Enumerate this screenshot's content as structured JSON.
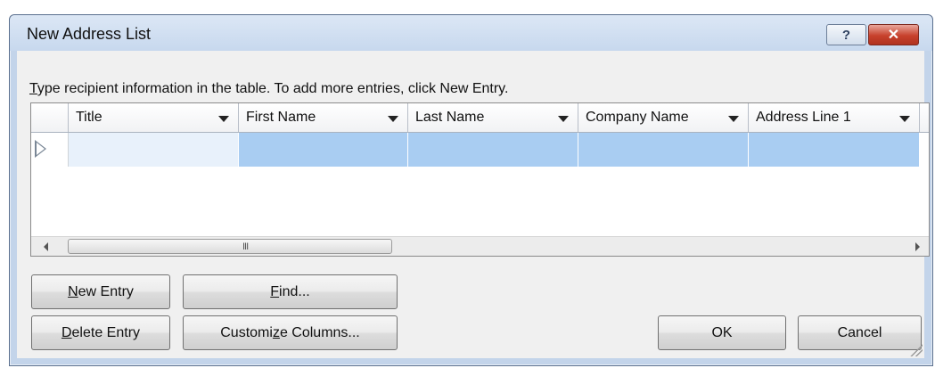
{
  "window": {
    "title": "New Address List",
    "help_label": "?",
    "close_label": "✕"
  },
  "instruction": {
    "mnemonic": "T",
    "rest": "ype recipient information in the table.  To add more entries, click New Entry."
  },
  "table": {
    "columns": [
      {
        "label": "Title"
      },
      {
        "label": "First Name"
      },
      {
        "label": "Last Name"
      },
      {
        "label": "Company Name"
      },
      {
        "label": "Address Line 1"
      }
    ],
    "rows": [
      {
        "cells": [
          "",
          "",
          "",
          "",
          ""
        ]
      }
    ],
    "scrollbar_grip": "III"
  },
  "buttons": {
    "new_entry": {
      "mnemonic": "N",
      "rest": "ew Entry"
    },
    "find": {
      "mnemonic": "F",
      "rest": "ind..."
    },
    "delete_entry": {
      "mnemonic": "D",
      "rest": "elete Entry"
    },
    "customize_columns": {
      "before": "Customi",
      "mnemonic": "z",
      "after": "e Columns..."
    },
    "ok": "OK",
    "cancel": "Cancel"
  },
  "colors": {
    "selected_row": "#a9cdf2",
    "frame": "#c3d4ea",
    "close_button": "#c7412c"
  }
}
